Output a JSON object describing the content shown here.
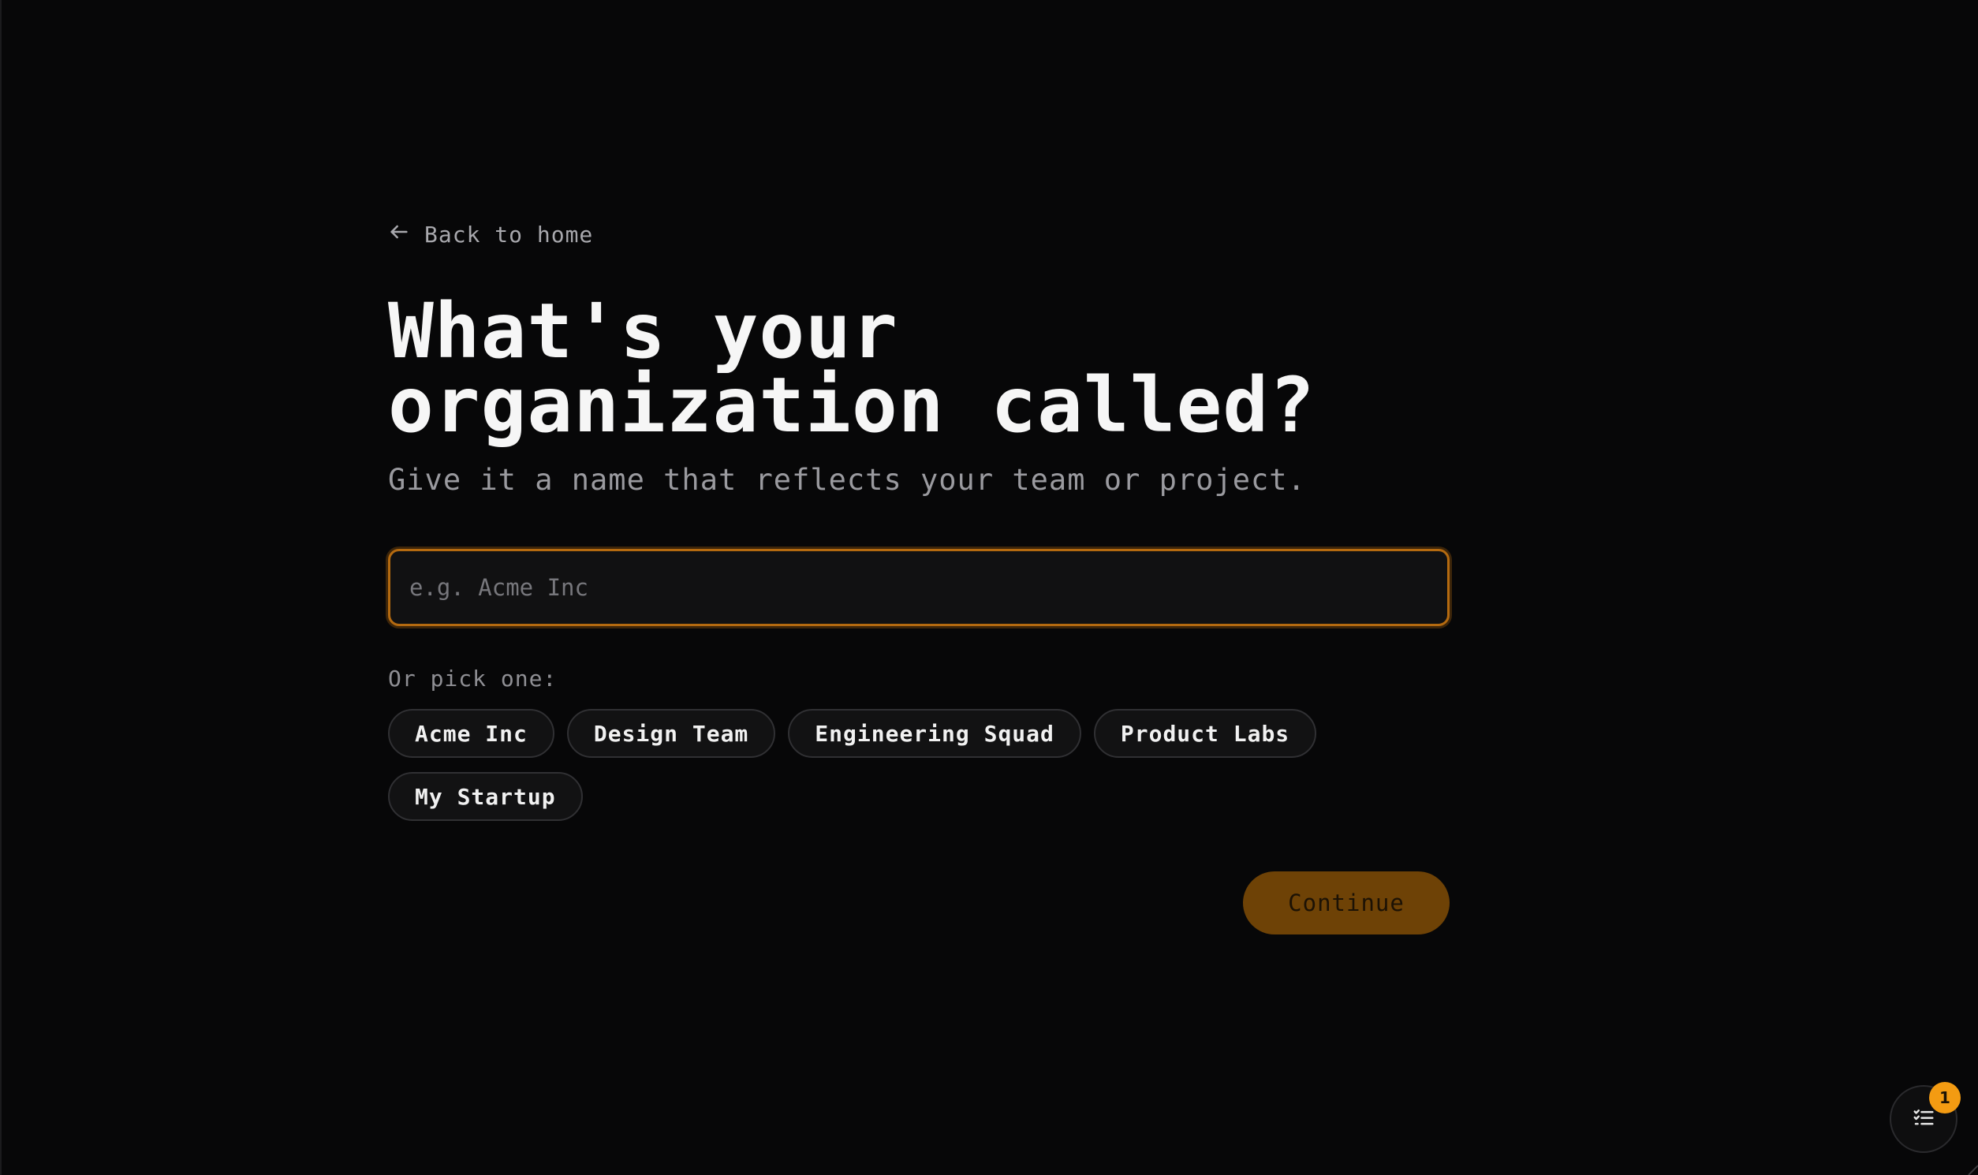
{
  "back_link": {
    "label": "Back to home",
    "icon": "arrow-left-icon"
  },
  "heading": {
    "title": "What's your organization called?",
    "subtitle": "Give it a name that reflects your team or project."
  },
  "name_input": {
    "value": "",
    "placeholder": "e.g. Acme Inc"
  },
  "suggestions": {
    "label": "Or pick one:",
    "items": [
      "Acme Inc",
      "Design Team",
      "Engineering Squad",
      "Product Labs",
      "My Startup"
    ]
  },
  "continue_button": {
    "label": "Continue"
  },
  "checklist_fab": {
    "icon": "checklist-icon",
    "badge": "1"
  },
  "colors": {
    "accent": "#b46a10",
    "button_bg": "#6e4206",
    "badge": "#f39b12",
    "background": "#070708"
  }
}
